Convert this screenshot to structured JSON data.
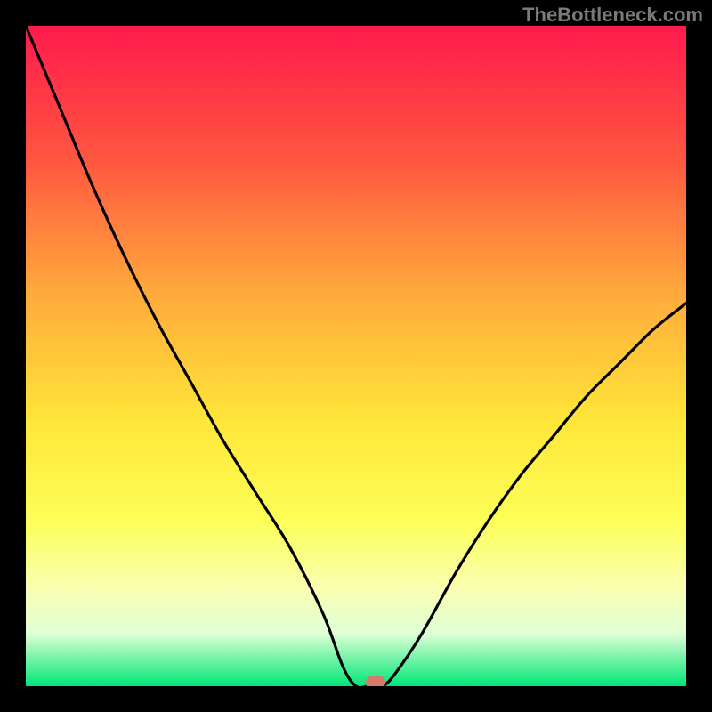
{
  "watermark": "TheBottleneck.com",
  "chart_data": {
    "type": "line",
    "title": "",
    "xlabel": "",
    "ylabel": "",
    "xlim": [
      0,
      100
    ],
    "ylim": [
      0,
      100
    ],
    "series": [
      {
        "name": "bottleneck-curve",
        "x": [
          0,
          5,
          10,
          15,
          20,
          25,
          30,
          35,
          40,
          45,
          48,
          50,
          52,
          54,
          56,
          60,
          65,
          70,
          75,
          80,
          85,
          90,
          95,
          100
        ],
        "y": [
          100,
          88,
          76,
          65,
          55,
          46,
          37,
          29,
          21,
          11,
          3,
          0,
          0,
          0,
          2,
          8,
          17,
          25,
          32,
          38,
          44,
          49,
          54,
          58
        ]
      }
    ],
    "marker": {
      "x": 53,
      "y": 0
    },
    "background_gradient": {
      "stops": [
        {
          "pos": 0,
          "color": "#ff1a4d"
        },
        {
          "pos": 20,
          "color": "#ff5540"
        },
        {
          "pos": 40,
          "color": "#ffa83c"
        },
        {
          "pos": 60,
          "color": "#ffe638"
        },
        {
          "pos": 75,
          "color": "#fcff58"
        },
        {
          "pos": 85,
          "color": "#f9ffb0"
        },
        {
          "pos": 92,
          "color": "#e0ffd6"
        },
        {
          "pos": 100,
          "color": "#00e676"
        }
      ]
    }
  }
}
